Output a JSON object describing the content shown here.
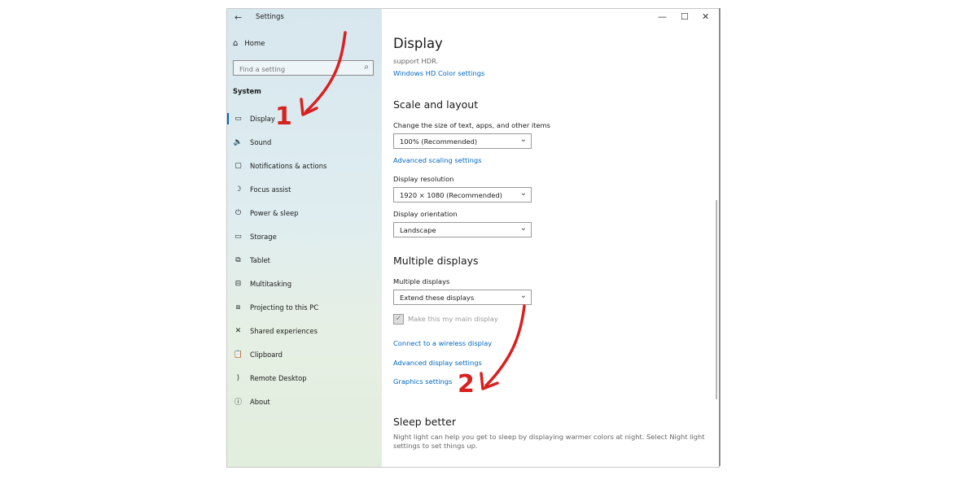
{
  "window": {
    "title": "Settings",
    "back_glyph": "←",
    "controls": {
      "minimize": "—",
      "maximize": "☐",
      "close": "✕"
    }
  },
  "sidebar": {
    "home_label": "Home",
    "search_placeholder": "Find a setting",
    "section_title": "System",
    "items": [
      {
        "label": "Display",
        "icon": "monitor-icon",
        "glyph": "▭"
      },
      {
        "label": "Sound",
        "icon": "speaker-icon",
        "glyph": "🔈"
      },
      {
        "label": "Notifications & actions",
        "icon": "message-icon",
        "glyph": "▢"
      },
      {
        "label": "Focus assist",
        "icon": "moon-icon",
        "glyph": "☽"
      },
      {
        "label": "Power & sleep",
        "icon": "power-icon",
        "glyph": "⏻"
      },
      {
        "label": "Storage",
        "icon": "storage-icon",
        "glyph": "▭"
      },
      {
        "label": "Tablet",
        "icon": "tablet-icon",
        "glyph": "⧉"
      },
      {
        "label": "Multitasking",
        "icon": "multitasking-icon",
        "glyph": "⊟"
      },
      {
        "label": "Projecting to this PC",
        "icon": "projector-icon",
        "glyph": "⧈"
      },
      {
        "label": "Shared experiences",
        "icon": "shared-icon",
        "glyph": "✕"
      },
      {
        "label": "Clipboard",
        "icon": "clipboard-icon",
        "glyph": "📋"
      },
      {
        "label": "Remote Desktop",
        "icon": "remote-icon",
        "glyph": "⟩"
      },
      {
        "label": "About",
        "icon": "info-icon",
        "glyph": "ⓘ"
      }
    ]
  },
  "main": {
    "page_title": "Display",
    "hdr_text": "support HDR.",
    "hdr_link": "Windows HD Color settings",
    "scale": {
      "heading": "Scale and layout",
      "size_label": "Change the size of text, apps, and other items",
      "size_value": "100% (Recommended)",
      "advanced_scaling_link": "Advanced scaling settings",
      "resolution_label": "Display resolution",
      "resolution_value": "1920 × 1080 (Recommended)",
      "orientation_label": "Display orientation",
      "orientation_value": "Landscape"
    },
    "multiple": {
      "heading": "Multiple displays",
      "label": "Multiple displays",
      "value": "Extend these displays",
      "main_display_checkbox": "Make this my main display",
      "wireless_link": "Connect to a wireless display",
      "advanced_link": "Advanced display settings",
      "graphics_link": "Graphics settings"
    },
    "sleep": {
      "heading": "Sleep better",
      "text": "Night light can help you get to sleep by displaying warmer colors at night. Select Night light settings to set things up."
    }
  },
  "annotations": {
    "marker_1": "1",
    "marker_2": "2",
    "color": "#d92020"
  }
}
